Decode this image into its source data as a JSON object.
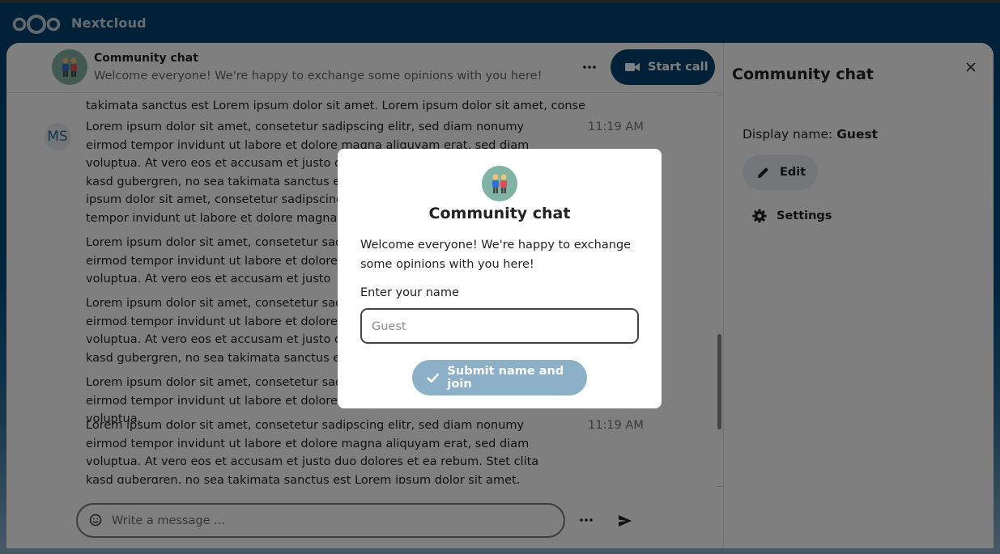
{
  "brand": {
    "name": "Nextcloud"
  },
  "header": {
    "title": "Community chat",
    "description": "Welcome everyone! We're happy to exchange some opinions with you here!",
    "start_call_label": "Start call"
  },
  "messages": {
    "fragment": "takimata sanctus est Lorem ipsum dolor sit amet. Lorem ipsum dolor sit amet, conse",
    "author_initials": "MS",
    "items": [
      {
        "text": "Lorem ipsum dolor sit amet, consetetur sadipscing elitr, sed diam nonumy eirmod tempor invidunt ut labore et dolore magna aliquyam erat, sed diam voluptua. At vero eos et accusam et justo duo dolores et ea rebum. Stet clita kasd gubergren, no sea takimata sanctus est Lorem ipsum dolor sit amet. Lorem ipsum dolor sit amet, consetetur sadipscing elitr, sed diam nonumy eirmod tempor invidunt ut labore et dolore magna aliquyam erat, sed diam voluptua.",
        "time": "11:19 AM"
      },
      {
        "text": "Lorem ipsum dolor sit amet, consetetur sadipscing elitr, sed diam nonumy eirmod tempor invidunt ut labore et dolore magna aliquyam erat, sed diam voluptua. At vero eos et accusam et justo"
      },
      {
        "text": "Lorem ipsum dolor sit amet, consetetur sadipscing elitr, sed diam nonumy eirmod tempor invidunt ut labore et dolore magna aliquyam erat, sed diam voluptua. At vero eos et accusam et justo duo dolores et ea rebum. Stet clita kasd gubergren, no sea takimata sanctus est Lorem ipsum dolor sit amet."
      },
      {
        "text": "Lorem ipsum dolor sit amet, consetetur sadipscing elitr, sed diam nonumy eirmod tempor invidunt ut labore et dolore magna aliquyam erat, sed diam voluptua."
      },
      {
        "text": "Lorem ipsum dolor sit amet, consetetur sadipscing elitr, sed diam nonumy eirmod tempor invidunt ut labore et dolore magna aliquyam erat, sed diam voluptua. At vero eos et accusam et justo duo dolores et ea rebum. Stet clita kasd gubergren, no sea takimata sanctus est Lorem ipsum dolor sit amet,",
        "time": "11:19 AM"
      }
    ]
  },
  "composer": {
    "placeholder": "Write a message ..."
  },
  "sidebar": {
    "title": "Community chat",
    "display_name_label": "Display name:",
    "display_name_value": "Guest",
    "edit_label": "Edit",
    "settings_label": "Settings"
  },
  "modal": {
    "title": "Community chat",
    "description": "Welcome everyone! We're happy to exchange some opinions with you here!",
    "name_label": "Enter your name",
    "name_placeholder": "Guest",
    "submit_label": "Submit name and join"
  },
  "colors": {
    "primary": "#00426f",
    "avatar_bg": "#80b3a3",
    "submit_disabled": "#8cb0c7"
  },
  "icons": [
    "nextcloud-logo",
    "people-emoji-icon",
    "more-icon",
    "video-camera-icon",
    "close-icon",
    "pencil-icon",
    "gear-icon",
    "emoji-icon",
    "send-icon",
    "check-icon"
  ]
}
